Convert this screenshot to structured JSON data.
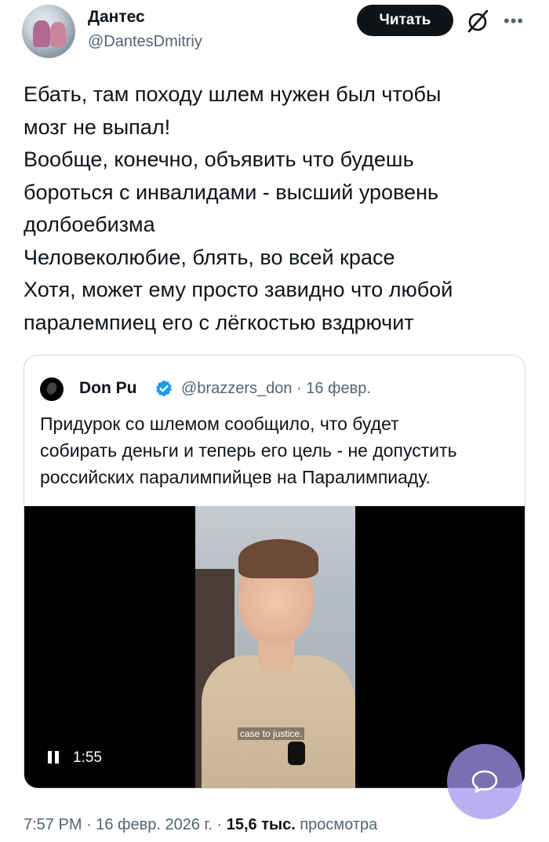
{
  "author": {
    "name": "Дантес",
    "handle": "@DantesDmitriy",
    "follow_label": "Читать"
  },
  "icons": {
    "grok": "grok-icon",
    "more": "more-icon",
    "verified": "verified-icon",
    "pause": "pause-icon",
    "fab": "message-icon"
  },
  "tweet": {
    "lines": [
      "Ебать, там походу шлем нужен был чтобы",
      "мозг не выпал!",
      "Вообще, конечно, объявить что будешь",
      "бороться с инвалидами - высший уровень",
      "долбоебизма",
      "Человеколюбие, блять, во всей красе",
      "Хотя, может ему просто завидно что любой",
      "паралемпиец его с лёгкостью вздрючит"
    ]
  },
  "quote": {
    "name": "Don Pu",
    "handle_line": "@brazzers_don · 16 февр.",
    "lines": [
      "Придурок со шлемом сообщило, что будет",
      "собирать деньги и теперь его цель - не допустить",
      "российских паралимпийцев на Паралимпиаду."
    ],
    "video": {
      "time": "1:55",
      "caption": "case to justice."
    }
  },
  "meta": {
    "time_date": "7:57 PM · 16 февр. 2026 г. · ",
    "views_count": "15,6 тыс.",
    "views_label": " просмотра"
  },
  "colors": {
    "text": "#0f1419",
    "secondary": "#536471",
    "verified": "#1d9bf0",
    "fab": "#a396ec"
  }
}
